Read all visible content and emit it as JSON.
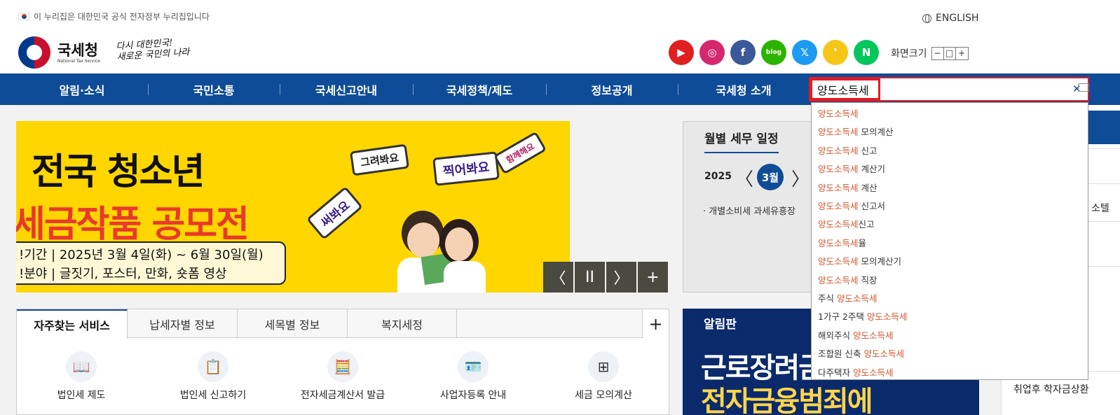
{
  "header": {
    "gov_notice": "이 누리집은 대한민국 공식 전자정부 누리집입니다",
    "english": "ENGLISH",
    "logo_kor": "국세청",
    "logo_eng": "National Tax Service",
    "slogan_line1": "다시 대한민국!",
    "slogan_line2": "새로운 국민의 나라",
    "font_size_label": "화면크기",
    "font_minus": "−",
    "font_reset": "□",
    "font_plus": "+",
    "social": [
      {
        "name": "youtube-icon",
        "glyph": "▶",
        "color": "#e02020"
      },
      {
        "name": "instagram-icon",
        "glyph": "◎",
        "color": "#d6286e"
      },
      {
        "name": "facebook-icon",
        "glyph": "f",
        "color": "#3b5998"
      },
      {
        "name": "blog-icon",
        "glyph": "blog",
        "color": "#2db400"
      },
      {
        "name": "x-icon",
        "glyph": "𝕏",
        "color": "#1d9bf0"
      },
      {
        "name": "kakao-story-icon",
        "glyph": "❜",
        "color": "#f5c518"
      },
      {
        "name": "naver-post-icon",
        "glyph": "N",
        "color": "#03c75a"
      }
    ]
  },
  "gnb": [
    "알림·소식",
    "국민소통",
    "국세신고안내",
    "국세정책/제도",
    "정보공개",
    "국세청 소개"
  ],
  "search": {
    "value": "양도소득세",
    "suggestions": [
      {
        "hl": "양도소득세",
        "rest": ""
      },
      {
        "hl": "양도소득세",
        "rest": " 모의계산"
      },
      {
        "hl": "양도소득세",
        "rest": " 신고"
      },
      {
        "hl": "양도소득세",
        "rest": " 계산기"
      },
      {
        "hl": "양도소득세",
        "rest": " 계산"
      },
      {
        "hl": "양도소득세",
        "rest": " 신고서"
      },
      {
        "hl": "양도소득세",
        "rest": "신고"
      },
      {
        "hl": "양도소득세",
        "rest": "율"
      },
      {
        "hl": "양도소득세",
        "rest": " 모의계산기"
      },
      {
        "hl": "양도소득세",
        "rest": " 직장"
      },
      {
        "pre": "주식 ",
        "hl": "양도소득세",
        "rest": ""
      },
      {
        "pre": "1가구 2주택 ",
        "hl": "양도소득세",
        "rest": ""
      },
      {
        "pre": "해외주식 ",
        "hl": "양도소득세",
        "rest": ""
      },
      {
        "pre": "조합원 신축 ",
        "hl": "양도소득세",
        "rest": ""
      },
      {
        "pre": "다주택자 ",
        "hl": "양도소득세",
        "rest": ""
      }
    ]
  },
  "banner": {
    "title1": "전국 청소년",
    "title2": "세금작품 공모전",
    "period": "!기간 | 2025년 3월 4일(화) ~ 6월 30일(월)",
    "field": "!분야 | 글짓기, 포스터, 만화, 숏폼 영상",
    "bubble1": "그려봐요",
    "bubble2": "찍어봐요",
    "bubble3": "써봐요",
    "bubble4": "함께해요"
  },
  "slider": {
    "prev": "〈",
    "pause": "II",
    "next": "〉",
    "more": "+"
  },
  "schedule": {
    "title": "월별 세무 일정",
    "year": "2025",
    "month": "3월",
    "prev": "〈",
    "next": "〉",
    "item": "· 개별소비세 과세유흥장"
  },
  "tabs": {
    "items": [
      "자주찾는 서비스",
      "납세자별 정보",
      "세목별 정보",
      "복지세정"
    ],
    "plus": "+",
    "services": [
      {
        "label": "법인세 제도",
        "icon": "📖"
      },
      {
        "label": "법인세 신고하기",
        "icon": "📋"
      },
      {
        "label": "전자세금계산서 발급",
        "icon": "🧮"
      },
      {
        "label": "사업자등록 안내",
        "icon": "🪪"
      },
      {
        "label": "세금 모의계산",
        "icon": "⊞"
      }
    ]
  },
  "notice": {
    "title": "알림판",
    "t1": "근로장려금",
    "t2": "전자금융범죄에"
  },
  "right": {
    "partial_text": "취업후 학자금상환",
    "partial_text2": "소텔"
  }
}
